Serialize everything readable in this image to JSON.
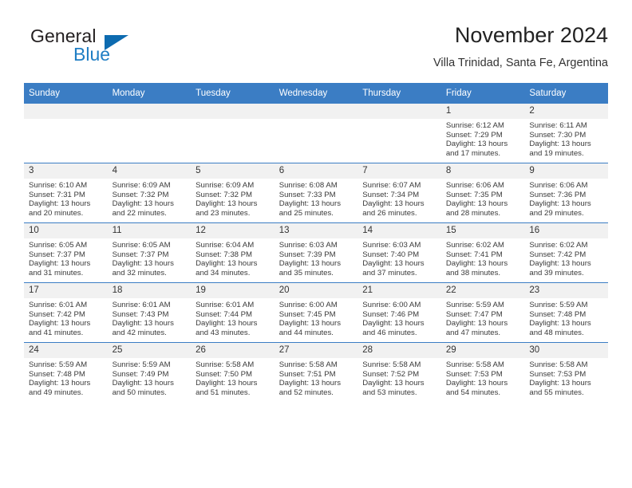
{
  "brand": {
    "word_one": "General",
    "word_two": "Blue",
    "triangle_icon": "triangle-icon",
    "accent_dark": "#0d6bb0",
    "accent_light": "#1f7ec4"
  },
  "header": {
    "title": "November 2024",
    "location": "Villa Trinidad, Santa Fe, Argentina"
  },
  "theme": {
    "header_blue": "#3b7dc4",
    "daynum_band": "#f1f1f1",
    "text": "#333333"
  },
  "weekdays": [
    "Sunday",
    "Monday",
    "Tuesday",
    "Wednesday",
    "Thursday",
    "Friday",
    "Saturday"
  ],
  "weeks": [
    [
      {
        "day": "",
        "sunrise": "",
        "sunset": "",
        "daylight_1": "",
        "daylight_2": ""
      },
      {
        "day": "",
        "sunrise": "",
        "sunset": "",
        "daylight_1": "",
        "daylight_2": ""
      },
      {
        "day": "",
        "sunrise": "",
        "sunset": "",
        "daylight_1": "",
        "daylight_2": ""
      },
      {
        "day": "",
        "sunrise": "",
        "sunset": "",
        "daylight_1": "",
        "daylight_2": ""
      },
      {
        "day": "",
        "sunrise": "",
        "sunset": "",
        "daylight_1": "",
        "daylight_2": ""
      },
      {
        "day": "1",
        "sunrise": "Sunrise: 6:12 AM",
        "sunset": "Sunset: 7:29 PM",
        "daylight_1": "Daylight: 13 hours",
        "daylight_2": "and 17 minutes."
      },
      {
        "day": "2",
        "sunrise": "Sunrise: 6:11 AM",
        "sunset": "Sunset: 7:30 PM",
        "daylight_1": "Daylight: 13 hours",
        "daylight_2": "and 19 minutes."
      }
    ],
    [
      {
        "day": "3",
        "sunrise": "Sunrise: 6:10 AM",
        "sunset": "Sunset: 7:31 PM",
        "daylight_1": "Daylight: 13 hours",
        "daylight_2": "and 20 minutes."
      },
      {
        "day": "4",
        "sunrise": "Sunrise: 6:09 AM",
        "sunset": "Sunset: 7:32 PM",
        "daylight_1": "Daylight: 13 hours",
        "daylight_2": "and 22 minutes."
      },
      {
        "day": "5",
        "sunrise": "Sunrise: 6:09 AM",
        "sunset": "Sunset: 7:32 PM",
        "daylight_1": "Daylight: 13 hours",
        "daylight_2": "and 23 minutes."
      },
      {
        "day": "6",
        "sunrise": "Sunrise: 6:08 AM",
        "sunset": "Sunset: 7:33 PM",
        "daylight_1": "Daylight: 13 hours",
        "daylight_2": "and 25 minutes."
      },
      {
        "day": "7",
        "sunrise": "Sunrise: 6:07 AM",
        "sunset": "Sunset: 7:34 PM",
        "daylight_1": "Daylight: 13 hours",
        "daylight_2": "and 26 minutes."
      },
      {
        "day": "8",
        "sunrise": "Sunrise: 6:06 AM",
        "sunset": "Sunset: 7:35 PM",
        "daylight_1": "Daylight: 13 hours",
        "daylight_2": "and 28 minutes."
      },
      {
        "day": "9",
        "sunrise": "Sunrise: 6:06 AM",
        "sunset": "Sunset: 7:36 PM",
        "daylight_1": "Daylight: 13 hours",
        "daylight_2": "and 29 minutes."
      }
    ],
    [
      {
        "day": "10",
        "sunrise": "Sunrise: 6:05 AM",
        "sunset": "Sunset: 7:37 PM",
        "daylight_1": "Daylight: 13 hours",
        "daylight_2": "and 31 minutes."
      },
      {
        "day": "11",
        "sunrise": "Sunrise: 6:05 AM",
        "sunset": "Sunset: 7:37 PM",
        "daylight_1": "Daylight: 13 hours",
        "daylight_2": "and 32 minutes."
      },
      {
        "day": "12",
        "sunrise": "Sunrise: 6:04 AM",
        "sunset": "Sunset: 7:38 PM",
        "daylight_1": "Daylight: 13 hours",
        "daylight_2": "and 34 minutes."
      },
      {
        "day": "13",
        "sunrise": "Sunrise: 6:03 AM",
        "sunset": "Sunset: 7:39 PM",
        "daylight_1": "Daylight: 13 hours",
        "daylight_2": "and 35 minutes."
      },
      {
        "day": "14",
        "sunrise": "Sunrise: 6:03 AM",
        "sunset": "Sunset: 7:40 PM",
        "daylight_1": "Daylight: 13 hours",
        "daylight_2": "and 37 minutes."
      },
      {
        "day": "15",
        "sunrise": "Sunrise: 6:02 AM",
        "sunset": "Sunset: 7:41 PM",
        "daylight_1": "Daylight: 13 hours",
        "daylight_2": "and 38 minutes."
      },
      {
        "day": "16",
        "sunrise": "Sunrise: 6:02 AM",
        "sunset": "Sunset: 7:42 PM",
        "daylight_1": "Daylight: 13 hours",
        "daylight_2": "and 39 minutes."
      }
    ],
    [
      {
        "day": "17",
        "sunrise": "Sunrise: 6:01 AM",
        "sunset": "Sunset: 7:42 PM",
        "daylight_1": "Daylight: 13 hours",
        "daylight_2": "and 41 minutes."
      },
      {
        "day": "18",
        "sunrise": "Sunrise: 6:01 AM",
        "sunset": "Sunset: 7:43 PM",
        "daylight_1": "Daylight: 13 hours",
        "daylight_2": "and 42 minutes."
      },
      {
        "day": "19",
        "sunrise": "Sunrise: 6:01 AM",
        "sunset": "Sunset: 7:44 PM",
        "daylight_1": "Daylight: 13 hours",
        "daylight_2": "and 43 minutes."
      },
      {
        "day": "20",
        "sunrise": "Sunrise: 6:00 AM",
        "sunset": "Sunset: 7:45 PM",
        "daylight_1": "Daylight: 13 hours",
        "daylight_2": "and 44 minutes."
      },
      {
        "day": "21",
        "sunrise": "Sunrise: 6:00 AM",
        "sunset": "Sunset: 7:46 PM",
        "daylight_1": "Daylight: 13 hours",
        "daylight_2": "and 46 minutes."
      },
      {
        "day": "22",
        "sunrise": "Sunrise: 5:59 AM",
        "sunset": "Sunset: 7:47 PM",
        "daylight_1": "Daylight: 13 hours",
        "daylight_2": "and 47 minutes."
      },
      {
        "day": "23",
        "sunrise": "Sunrise: 5:59 AM",
        "sunset": "Sunset: 7:48 PM",
        "daylight_1": "Daylight: 13 hours",
        "daylight_2": "and 48 minutes."
      }
    ],
    [
      {
        "day": "24",
        "sunrise": "Sunrise: 5:59 AM",
        "sunset": "Sunset: 7:48 PM",
        "daylight_1": "Daylight: 13 hours",
        "daylight_2": "and 49 minutes."
      },
      {
        "day": "25",
        "sunrise": "Sunrise: 5:59 AM",
        "sunset": "Sunset: 7:49 PM",
        "daylight_1": "Daylight: 13 hours",
        "daylight_2": "and 50 minutes."
      },
      {
        "day": "26",
        "sunrise": "Sunrise: 5:58 AM",
        "sunset": "Sunset: 7:50 PM",
        "daylight_1": "Daylight: 13 hours",
        "daylight_2": "and 51 minutes."
      },
      {
        "day": "27",
        "sunrise": "Sunrise: 5:58 AM",
        "sunset": "Sunset: 7:51 PM",
        "daylight_1": "Daylight: 13 hours",
        "daylight_2": "and 52 minutes."
      },
      {
        "day": "28",
        "sunrise": "Sunrise: 5:58 AM",
        "sunset": "Sunset: 7:52 PM",
        "daylight_1": "Daylight: 13 hours",
        "daylight_2": "and 53 minutes."
      },
      {
        "day": "29",
        "sunrise": "Sunrise: 5:58 AM",
        "sunset": "Sunset: 7:53 PM",
        "daylight_1": "Daylight: 13 hours",
        "daylight_2": "and 54 minutes."
      },
      {
        "day": "30",
        "sunrise": "Sunrise: 5:58 AM",
        "sunset": "Sunset: 7:53 PM",
        "daylight_1": "Daylight: 13 hours",
        "daylight_2": "and 55 minutes."
      }
    ]
  ]
}
